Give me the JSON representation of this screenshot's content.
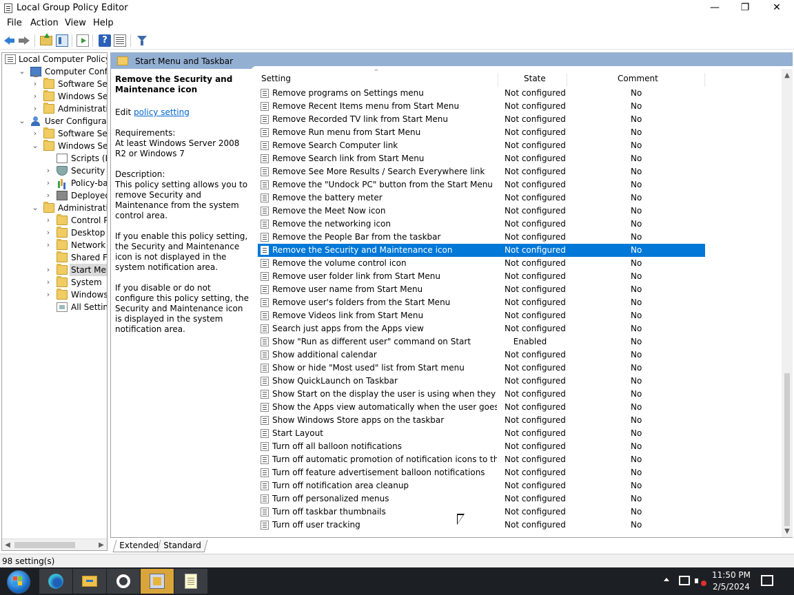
{
  "window": {
    "title": "Local Group Policy Editor",
    "min_icon": "—",
    "max_icon": "❐",
    "close_icon": "✕"
  },
  "menu": [
    "File",
    "Action",
    "View",
    "Help"
  ],
  "toolbar": {
    "help_label": "?"
  },
  "tree": {
    "items": [
      {
        "label": "Local Computer Policy",
        "level": 0,
        "expander": "",
        "icon": "policy-icon"
      },
      {
        "label": "Computer Configura",
        "level": 1,
        "expander": "⌄",
        "icon": "computer-icon"
      },
      {
        "label": "Software Settings",
        "level": 2,
        "expander": "›",
        "icon": "folder-icon"
      },
      {
        "label": "Windows Setting",
        "level": 2,
        "expander": "›",
        "icon": "folder-icon"
      },
      {
        "label": "Administrative Te",
        "level": 2,
        "expander": "›",
        "icon": "folder-icon"
      },
      {
        "label": "User Configuration",
        "level": 1,
        "expander": "⌄",
        "icon": "user-icon"
      },
      {
        "label": "Software Settings",
        "level": 2,
        "expander": "›",
        "icon": "folder-icon"
      },
      {
        "label": "Windows Setting",
        "level": 2,
        "expander": "⌄",
        "icon": "folder-icon"
      },
      {
        "label": "Scripts (Logo",
        "level": 3,
        "expander": "",
        "icon": "scripts-icon"
      },
      {
        "label": "Security Settir",
        "level": 3,
        "expander": "›",
        "icon": "shield-icon"
      },
      {
        "label": "Policy-based",
        "level": 3,
        "expander": "›",
        "icon": "chart-icon"
      },
      {
        "label": "Deployed Prin",
        "level": 3,
        "expander": "›",
        "icon": "printer-icon"
      },
      {
        "label": "Administrative Te",
        "level": 2,
        "expander": "⌄",
        "icon": "folder-icon"
      },
      {
        "label": "Control Panel",
        "level": 3,
        "expander": "›",
        "icon": "folder-icon"
      },
      {
        "label": "Desktop",
        "level": 3,
        "expander": "›",
        "icon": "folder-icon"
      },
      {
        "label": "Network",
        "level": 3,
        "expander": "›",
        "icon": "folder-icon"
      },
      {
        "label": "Shared Folder",
        "level": 3,
        "expander": "",
        "icon": "folder-icon"
      },
      {
        "label": "Start Menu ar",
        "level": 3,
        "expander": "›",
        "icon": "folder-icon",
        "selected": true
      },
      {
        "label": "System",
        "level": 3,
        "expander": "›",
        "icon": "folder-icon"
      },
      {
        "label": "Windows Cor",
        "level": 3,
        "expander": "›",
        "icon": "folder-icon"
      },
      {
        "label": "All Settings",
        "level": 3,
        "expander": "",
        "icon": "settings-icon"
      }
    ]
  },
  "right_header": {
    "title": "Start Menu and Taskbar"
  },
  "description": {
    "title": "Remove the Security and Maintenance icon",
    "edit_prefix": "Edit ",
    "edit_link": "policy setting ",
    "requirements_label": "Requirements:",
    "requirements": "At least Windows Server 2008 R2 or Windows 7",
    "description_label": "Description:",
    "description": "This policy setting allows you to remove Security and Maintenance from the system control area.",
    "p_enable": "If you enable this policy setting, the Security and Maintenance icon is not displayed in the system notification area.",
    "p_disable": "If you disable or do not configure this policy setting, the Security and Maintenance icon is displayed in the system notification area."
  },
  "columns": {
    "setting": "Setting",
    "state": "State",
    "comment": "Comment"
  },
  "rows": [
    {
      "name": "Remove programs on Settings menu",
      "state": "Not configured",
      "comment": "No"
    },
    {
      "name": "Remove Recent Items menu from Start Menu",
      "state": "Not configured",
      "comment": "No"
    },
    {
      "name": "Remove Recorded TV link from Start Menu",
      "state": "Not configured",
      "comment": "No"
    },
    {
      "name": "Remove Run menu from Start Menu",
      "state": "Not configured",
      "comment": "No"
    },
    {
      "name": "Remove Search Computer link",
      "state": "Not configured",
      "comment": "No"
    },
    {
      "name": "Remove Search link from Start Menu",
      "state": "Not configured",
      "comment": "No"
    },
    {
      "name": "Remove See More Results / Search Everywhere link",
      "state": "Not configured",
      "comment": "No"
    },
    {
      "name": "Remove the \"Undock PC\" button from the Start Menu",
      "state": "Not configured",
      "comment": "No"
    },
    {
      "name": "Remove the battery meter",
      "state": "Not configured",
      "comment": "No"
    },
    {
      "name": "Remove the Meet Now icon",
      "state": "Not configured",
      "comment": "No"
    },
    {
      "name": "Remove the networking icon",
      "state": "Not configured",
      "comment": "No"
    },
    {
      "name": "Remove the People Bar from the taskbar",
      "state": "Not configured",
      "comment": "No"
    },
    {
      "name": "Remove the Security and Maintenance icon",
      "state": "Not configured",
      "comment": "No",
      "selected": true
    },
    {
      "name": "Remove the volume control icon",
      "state": "Not configured",
      "comment": "No"
    },
    {
      "name": "Remove user folder link from Start Menu",
      "state": "Not configured",
      "comment": "No"
    },
    {
      "name": "Remove user name from Start Menu",
      "state": "Not configured",
      "comment": "No"
    },
    {
      "name": "Remove user's folders from the Start Menu",
      "state": "Not configured",
      "comment": "No"
    },
    {
      "name": "Remove Videos link from Start Menu",
      "state": "Not configured",
      "comment": "No"
    },
    {
      "name": "Search just apps from the Apps view",
      "state": "Not configured",
      "comment": "No"
    },
    {
      "name": "Show \"Run as different user\" command on Start",
      "state": "Enabled",
      "comment": "No"
    },
    {
      "name": "Show additional calendar",
      "state": "Not configured",
      "comment": "No"
    },
    {
      "name": "Show or hide \"Most used\" list from Start menu",
      "state": "Not configured",
      "comment": "No"
    },
    {
      "name": "Show QuickLaunch on Taskbar",
      "state": "Not configured",
      "comment": "No"
    },
    {
      "name": "Show Start on the display the user is using when they press t...",
      "state": "Not configured",
      "comment": "No"
    },
    {
      "name": "Show the Apps view automatically when the user goes to St...",
      "state": "Not configured",
      "comment": "No"
    },
    {
      "name": "Show Windows Store apps on the taskbar",
      "state": "Not configured",
      "comment": "No"
    },
    {
      "name": "Start Layout",
      "state": "Not configured",
      "comment": "No"
    },
    {
      "name": "Turn off all balloon notifications",
      "state": "Not configured",
      "comment": "No"
    },
    {
      "name": "Turn off automatic promotion of notification icons to the ta...",
      "state": "Not configured",
      "comment": "No"
    },
    {
      "name": "Turn off feature advertisement balloon notifications",
      "state": "Not configured",
      "comment": "No"
    },
    {
      "name": "Turn off notification area cleanup",
      "state": "Not configured",
      "comment": "No"
    },
    {
      "name": "Turn off personalized menus",
      "state": "Not configured",
      "comment": "No"
    },
    {
      "name": "Turn off taskbar thumbnails",
      "state": "Not configured",
      "comment": "No"
    },
    {
      "name": "Turn off user tracking",
      "state": "Not configured",
      "comment": "No"
    }
  ],
  "tabs": {
    "extended": "Extended",
    "standard": "Standard"
  },
  "status": {
    "text": "98 setting(s)"
  },
  "taskbar": {
    "time": "11:50 PM",
    "date": "2/5/2024"
  }
}
